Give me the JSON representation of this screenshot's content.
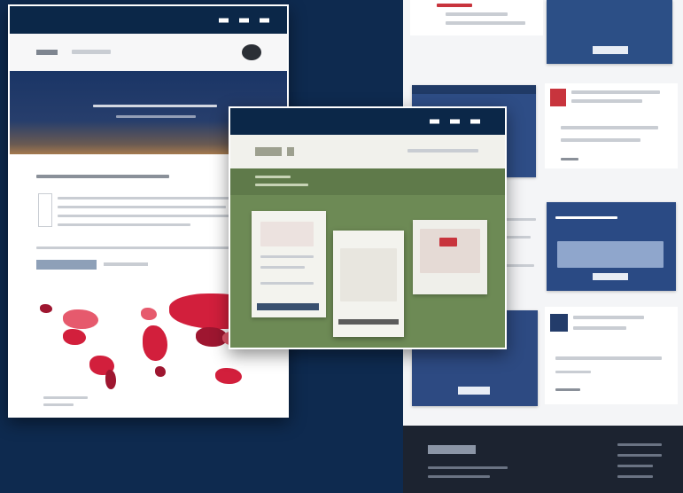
{
  "colors": {
    "background": "#0e2a4f",
    "title_bar": "#0b2748",
    "hero": "#1a3566",
    "app_green": "#6d8a55",
    "map_red": "#d21f3c",
    "footer": "#1c2330"
  },
  "icons": {
    "window_controls": "three-dash-icon",
    "logo": "logo-icon",
    "map": "world-map-icon"
  }
}
